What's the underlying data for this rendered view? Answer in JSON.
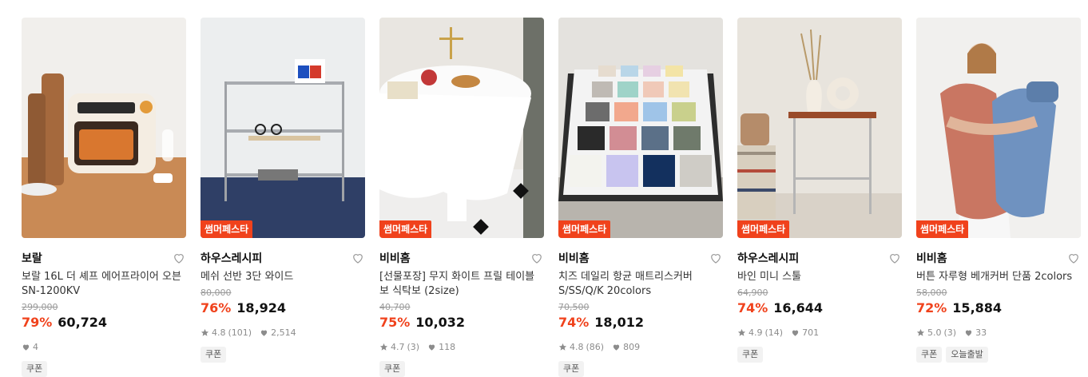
{
  "products": [
    {
      "brand": "보랄",
      "title": "보랄 16L 더 셰프 에어프라이어 오븐 SN-1200KV",
      "original_price": "299,000",
      "discount": "79%",
      "price": "60,724",
      "rating": "",
      "reviews": "",
      "likes": "4",
      "tags": [
        "쿠폰"
      ],
      "badge": ""
    },
    {
      "brand": "하우스레시피",
      "title": "메쉬 선반 3단 와이드",
      "original_price": "80,000",
      "discount": "76%",
      "price": "18,924",
      "rating": "4.8",
      "reviews": "(101)",
      "likes": "2,514",
      "tags": [
        "쿠폰"
      ],
      "badge": "썸머페스타"
    },
    {
      "brand": "비비홈",
      "title": "[선물포장] 무지 화이트 프릴 테이블보 식탁보 (2size)",
      "original_price": "40,700",
      "discount": "75%",
      "price": "10,032",
      "rating": "4.7",
      "reviews": "(3)",
      "likes": "118",
      "tags": [
        "쿠폰"
      ],
      "badge": "썸머페스타"
    },
    {
      "brand": "비비홈",
      "title": "치즈 데일리 항균 매트리스커버 S/SS/Q/K 20colors",
      "original_price": "70,500",
      "discount": "74%",
      "price": "18,012",
      "rating": "4.8",
      "reviews": "(86)",
      "likes": "809",
      "tags": [
        "쿠폰"
      ],
      "badge": "썸머페스타"
    },
    {
      "brand": "하우스레시피",
      "title": "바인 미니 스툴",
      "original_price": "64,900",
      "discount": "74%",
      "price": "16,644",
      "rating": "4.9",
      "reviews": "(14)",
      "likes": "701",
      "tags": [
        "쿠폰"
      ],
      "badge": "썸머페스타"
    },
    {
      "brand": "비비홈",
      "title": "버튼 자루형 베개커버 단품 2colors",
      "original_price": "58,000",
      "discount": "72%",
      "price": "15,884",
      "rating": "5.0",
      "reviews": "(3)",
      "likes": "33",
      "tags": [
        "쿠폰",
        "오늘출발"
      ],
      "badge": "썸머페스타"
    }
  ],
  "colors": {
    "accent": "#f0421c",
    "text": "#111111",
    "muted": "#8c8c8c"
  },
  "icons": {
    "like": "heart-outline-icon",
    "rating": "star-icon",
    "likes": "heart-filled-icon"
  }
}
